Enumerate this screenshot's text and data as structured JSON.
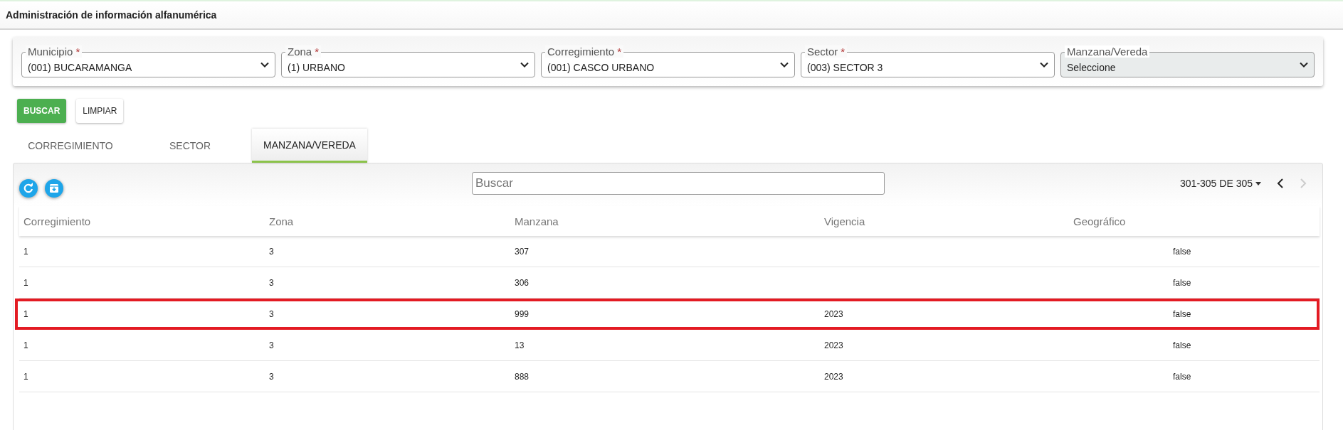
{
  "header": {
    "title": "Administración de información alfanumérica"
  },
  "filters": [
    {
      "label": "Municipio",
      "required_mark": "*",
      "value": "(001) BUCARAMANGA",
      "disabled": false
    },
    {
      "label": "Zona",
      "required_mark": "*",
      "value": "(1) URBANO",
      "disabled": false
    },
    {
      "label": "Corregimiento",
      "required_mark": "*",
      "value": "(001) CASCO URBANO",
      "disabled": false
    },
    {
      "label": "Sector",
      "required_mark": "*",
      "value": "(003) SECTOR 3",
      "disabled": false
    },
    {
      "label": "Manzana/Vereda",
      "value": "Seleccione",
      "disabled": true
    }
  ],
  "buttons": [
    {
      "label": "BUSCAR",
      "kind": "primary"
    },
    {
      "label": "LIMPIAR",
      "kind": "secondary"
    }
  ],
  "tabs": [
    {
      "label": "CORREGIMIENTO",
      "selected": false
    },
    {
      "label": "SECTOR",
      "selected": false
    },
    {
      "label": "MANZANA/VEREDA",
      "selected": true
    }
  ],
  "table": {
    "search": {
      "placeholder": "Buscar"
    },
    "pagination": {
      "range": "301-305 DE 305",
      "prev_disabled": false,
      "next_disabled": true
    },
    "columns": [
      "Corregimiento",
      "Zona",
      "Manzana",
      "Vigencia",
      "Geográfico"
    ],
    "rows": [
      {
        "corregimiento": "1",
        "zona": "3",
        "manzana": "307",
        "column_6": "false",
        "highlighted": false
      },
      {
        "corregimiento": "1",
        "zona": "3",
        "manzana": "306",
        "column_6": "false",
        "highlighted": false
      },
      {
        "corregimiento": "1",
        "zona": "3",
        "manzana": "999",
        "vigencia": "2023",
        "column_6": "false",
        "highlighted": true
      },
      {
        "corregimiento": "1",
        "zona": "3",
        "manzana": "13",
        "vigencia": "2023",
        "column_6": "false",
        "highlighted": false
      },
      {
        "corregimiento": "1",
        "zona": "3",
        "manzana": "888",
        "vigencia": "2023",
        "column_6": "false",
        "highlighted": false
      }
    ]
  }
}
